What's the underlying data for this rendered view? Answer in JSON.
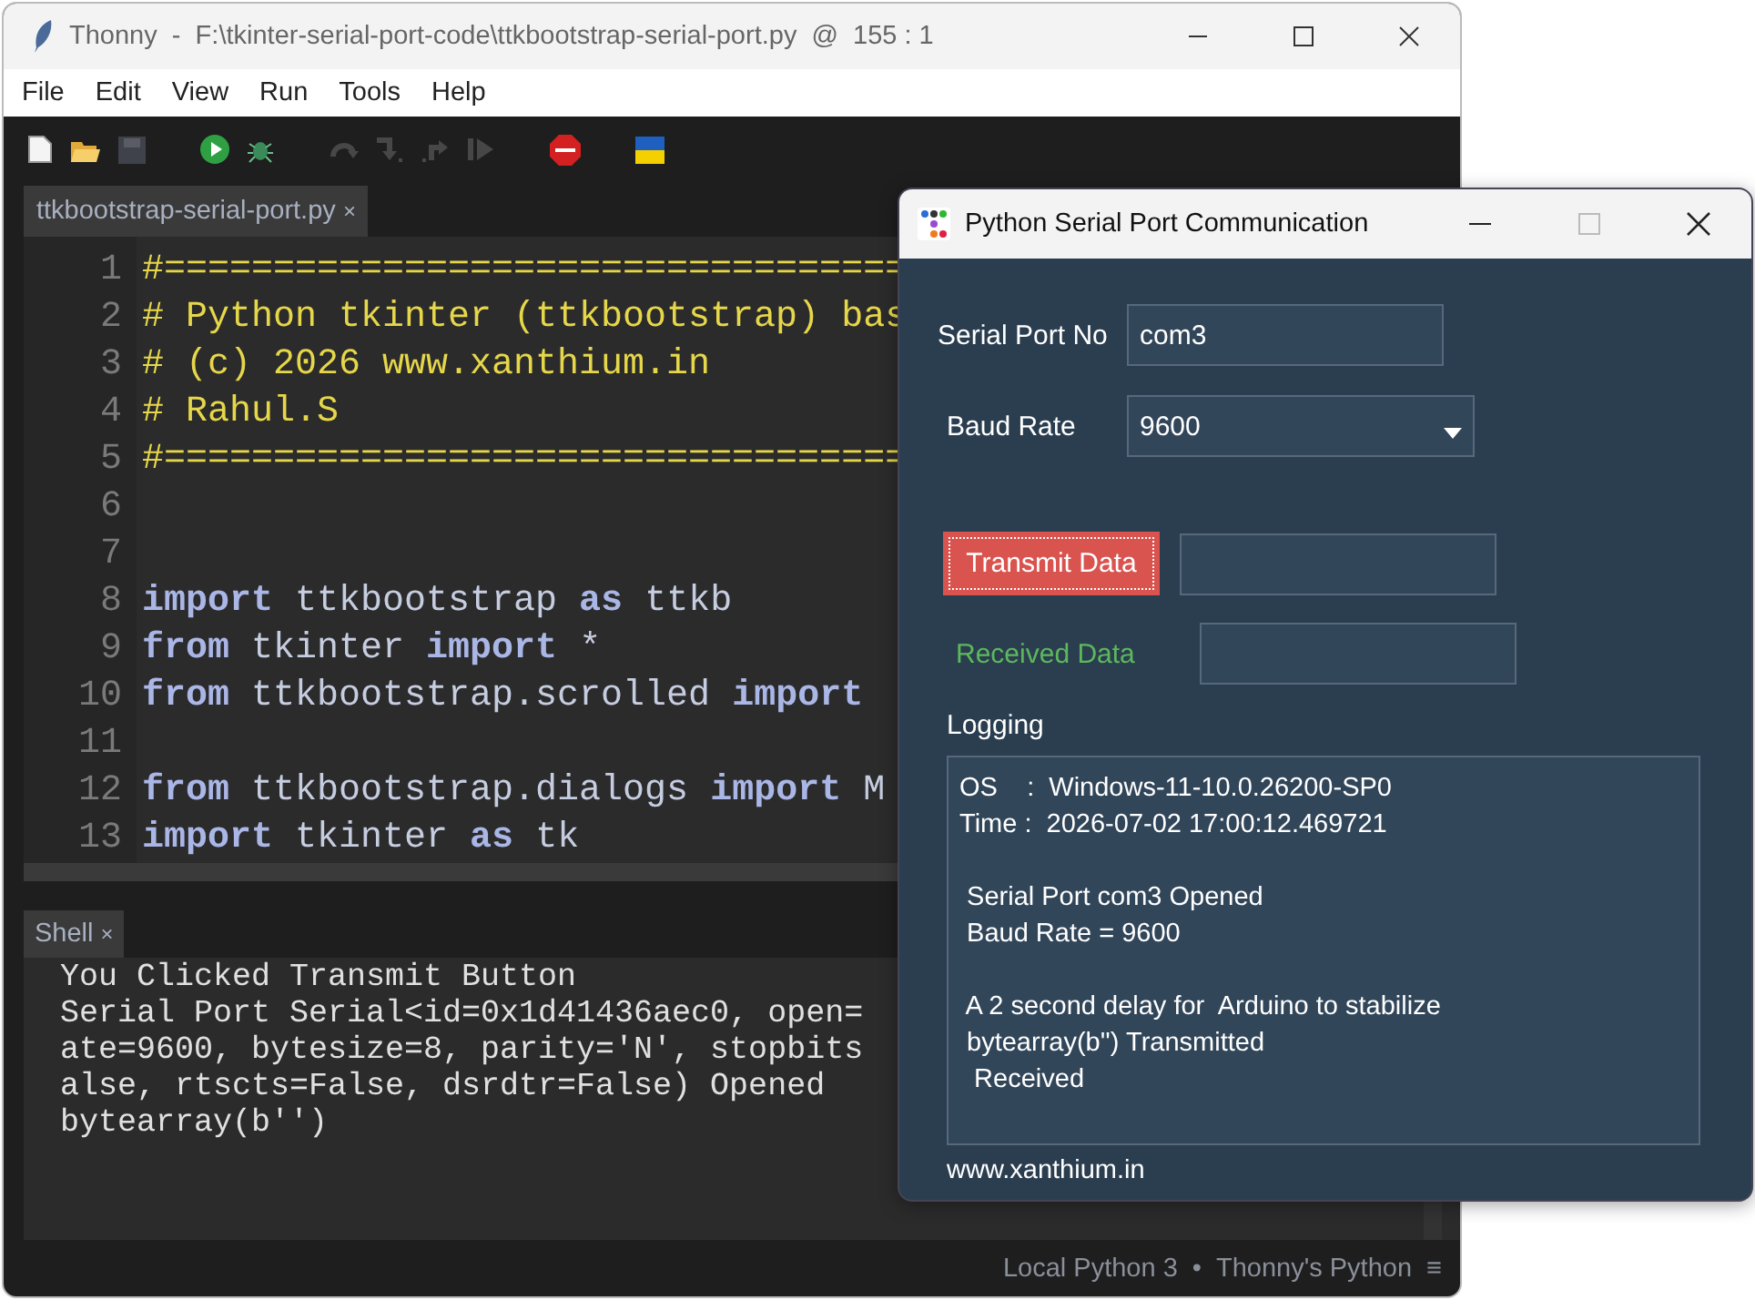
{
  "thonny": {
    "title": "Thonny  -  F:\\tkinter-serial-port-code\\ttkbootstrap-serial-port.py  @  155 : 1",
    "menu": [
      "File",
      "Edit",
      "View",
      "Run",
      "Tools",
      "Help"
    ],
    "toolbar": [
      {
        "kind": "new",
        "disabled": false
      },
      {
        "kind": "open",
        "disabled": false
      },
      {
        "kind": "save",
        "disabled": true
      },
      {
        "kind": "run",
        "disabled": false
      },
      {
        "kind": "debug",
        "disabled": false
      },
      {
        "kind": "step-over",
        "disabled": true
      },
      {
        "kind": "step-into",
        "disabled": true
      },
      {
        "kind": "step-out",
        "disabled": true
      },
      {
        "kind": "resume",
        "disabled": true
      },
      {
        "kind": "stop",
        "disabled": false
      },
      {
        "kind": "flag",
        "disabled": false
      }
    ],
    "editor_tab": {
      "label": "ttkbootstrap-serial-port.py",
      "close": "×"
    },
    "code_lines": [
      {
        "number": "1",
        "tokens": [
          {
            "kind": "comment",
            "text": "#=================================="
          }
        ]
      },
      {
        "number": "2",
        "tokens": [
          {
            "kind": "comment",
            "text": "# Python tkinter (ttkbootstrap) bas"
          }
        ]
      },
      {
        "number": "3",
        "tokens": [
          {
            "kind": "comment",
            "text": "# (c) 2026 www.xanthium.in"
          }
        ]
      },
      {
        "number": "4",
        "tokens": [
          {
            "kind": "comment",
            "text": "# Rahul.S"
          }
        ]
      },
      {
        "number": "5",
        "tokens": [
          {
            "kind": "comment",
            "text": "#=================================="
          }
        ]
      },
      {
        "number": "6"
      },
      {
        "number": "7"
      },
      {
        "number": "8",
        "tokens": [
          {
            "kind": "keyword",
            "text": "import"
          },
          {
            "kind": "name",
            "text": " ttkbootstrap "
          },
          {
            "kind": "keyword",
            "text": "as"
          },
          {
            "kind": "name",
            "text": " ttkb"
          }
        ]
      },
      {
        "number": "9",
        "tokens": [
          {
            "kind": "keyword",
            "text": "from"
          },
          {
            "kind": "name",
            "text": " tkinter "
          },
          {
            "kind": "keyword",
            "text": "import"
          },
          {
            "kind": "name",
            "text": " *"
          }
        ]
      },
      {
        "number": "10",
        "tokens": [
          {
            "kind": "keyword",
            "text": "from"
          },
          {
            "kind": "name",
            "text": " ttkbootstrap.scrolled "
          },
          {
            "kind": "keyword",
            "text": "import"
          }
        ]
      },
      {
        "number": "11"
      },
      {
        "number": "12",
        "tokens": [
          {
            "kind": "keyword",
            "text": "from"
          },
          {
            "kind": "name",
            "text": " ttkbootstrap.dialogs "
          },
          {
            "kind": "keyword",
            "text": "import"
          },
          {
            "kind": "name",
            "text": " M"
          }
        ]
      },
      {
        "number": "13",
        "tokens": [
          {
            "kind": "keyword",
            "text": "import"
          },
          {
            "kind": "name",
            "text": " tkinter "
          },
          {
            "kind": "keyword",
            "text": "as"
          },
          {
            "kind": "name",
            "text": " tk"
          }
        ]
      }
    ],
    "shell": {
      "tab": "Shell",
      "close": "×",
      "lines": [
        "You Clicked Transmit Button",
        "Serial Port Serial<id=0x1d41436aec0, open=",
        "ate=9600, bytesize=8, parity='N', stopbits",
        "alse, rtscts=False, dsrdtr=False) Opened",
        "bytearray(b'')"
      ]
    },
    "status_bar": {
      "interpreter": "Local Python 3",
      "separator": "•",
      "backend": "Thonny's Python",
      "menu": "≡"
    }
  },
  "dialog": {
    "title": "Python Serial Port Communication",
    "port": {
      "label": "Serial Port No",
      "value": "com3"
    },
    "baud": {
      "label": "Baud Rate",
      "value": "9600"
    },
    "transmit": {
      "button": "Transmit Data",
      "focused": true
    },
    "received": {
      "label": "Received Data"
    },
    "logging": {
      "label": "Logging",
      "blocks": [
        [
          "OS    :  Windows-11-10.0.26200-SP0",
          "Time :  2026-07-02 17:00:12.469721"
        ],
        [
          " Serial Port com3 Opened",
          " Baud Rate = 9600"
        ],
        [
          " A 2 second delay for  Arduino to stabilize",
          " bytearray(b'') Transmitted",
          "  Received"
        ]
      ]
    },
    "footer": "www.xanthium.in"
  }
}
